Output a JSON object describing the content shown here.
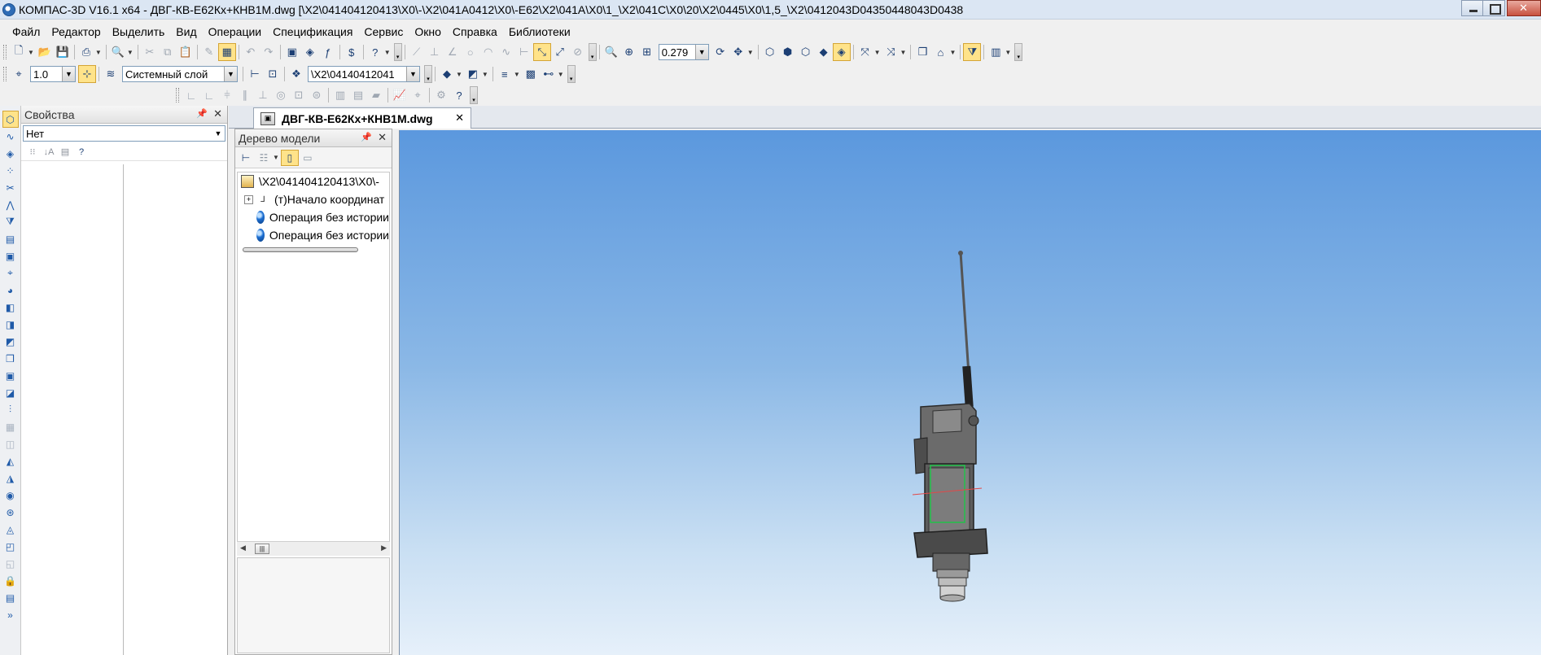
{
  "window": {
    "title": "КОМПАС-3D V16.1 x64 - ДВГ-КВ-Е62Кх+КНВ1М.dwg [\\X2\\041404120413\\X0\\-\\X2\\041A0412\\X0\\-E62\\X2\\041A\\X0\\1_\\X2\\041C\\X0\\20\\X2\\0445\\X0\\1,5_\\X2\\0412043D04350448043D0438"
  },
  "menu": [
    "Файл",
    "Редактор",
    "Выделить",
    "Вид",
    "Операции",
    "Спецификация",
    "Сервис",
    "Окно",
    "Справка",
    "Библиотеки"
  ],
  "toolbar": {
    "zoom_value": "0.279",
    "line_scale": "1.0",
    "layer": "Системный слой",
    "variant": "\\X2\\04140412041"
  },
  "properties_panel": {
    "title": "Свойства",
    "selection": "Нет"
  },
  "document_tab": {
    "label": "ДВГ-КВ-Е62Кх+КНВ1М.dwg"
  },
  "model_tree": {
    "title": "Дерево модели",
    "items": [
      {
        "label": "\\X2\\041404120413\\X0\\-",
        "icon": "assembly-icon"
      },
      {
        "label": "(т)Начало координат",
        "icon": "axes-icon"
      },
      {
        "label": "Операция без истории",
        "icon": "body-icon"
      },
      {
        "label": "Операция без истории",
        "icon": "body-icon"
      }
    ]
  },
  "colors": {
    "viewport_top": "#5b98de",
    "viewport_bottom": "#e6f0fa",
    "active_button": "#ffe38a"
  }
}
